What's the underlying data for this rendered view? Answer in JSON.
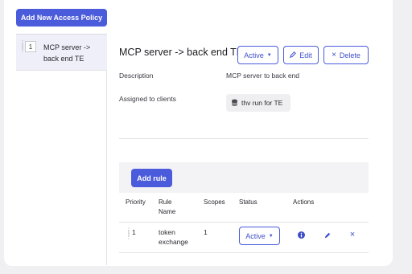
{
  "toolbar": {
    "add_policy_label": "Add New Access Policy"
  },
  "sidebar": {
    "items": [
      {
        "number": "1",
        "label": "MCP server -> back end TE"
      }
    ]
  },
  "policy": {
    "title": "MCP server -> back end TE",
    "status_label": "Active",
    "edit_label": "Edit",
    "delete_label": "Delete",
    "description_label": "Description",
    "description_value": "MCP server to back end",
    "clients_label": "Assigned to clients",
    "clients": [
      "thv run for TE"
    ]
  },
  "rules": {
    "add_label": "Add rule",
    "columns": [
      "Priority",
      "Rule Name",
      "Scopes",
      "Status",
      "Actions"
    ],
    "rows": [
      {
        "priority": "1",
        "name": "token exchange",
        "scopes": "1",
        "status": "Active"
      }
    ]
  },
  "colors": {
    "accent": "#4a5bdc",
    "sidebar_selected": "#eeeff8",
    "chip_bg": "#efeff1"
  }
}
